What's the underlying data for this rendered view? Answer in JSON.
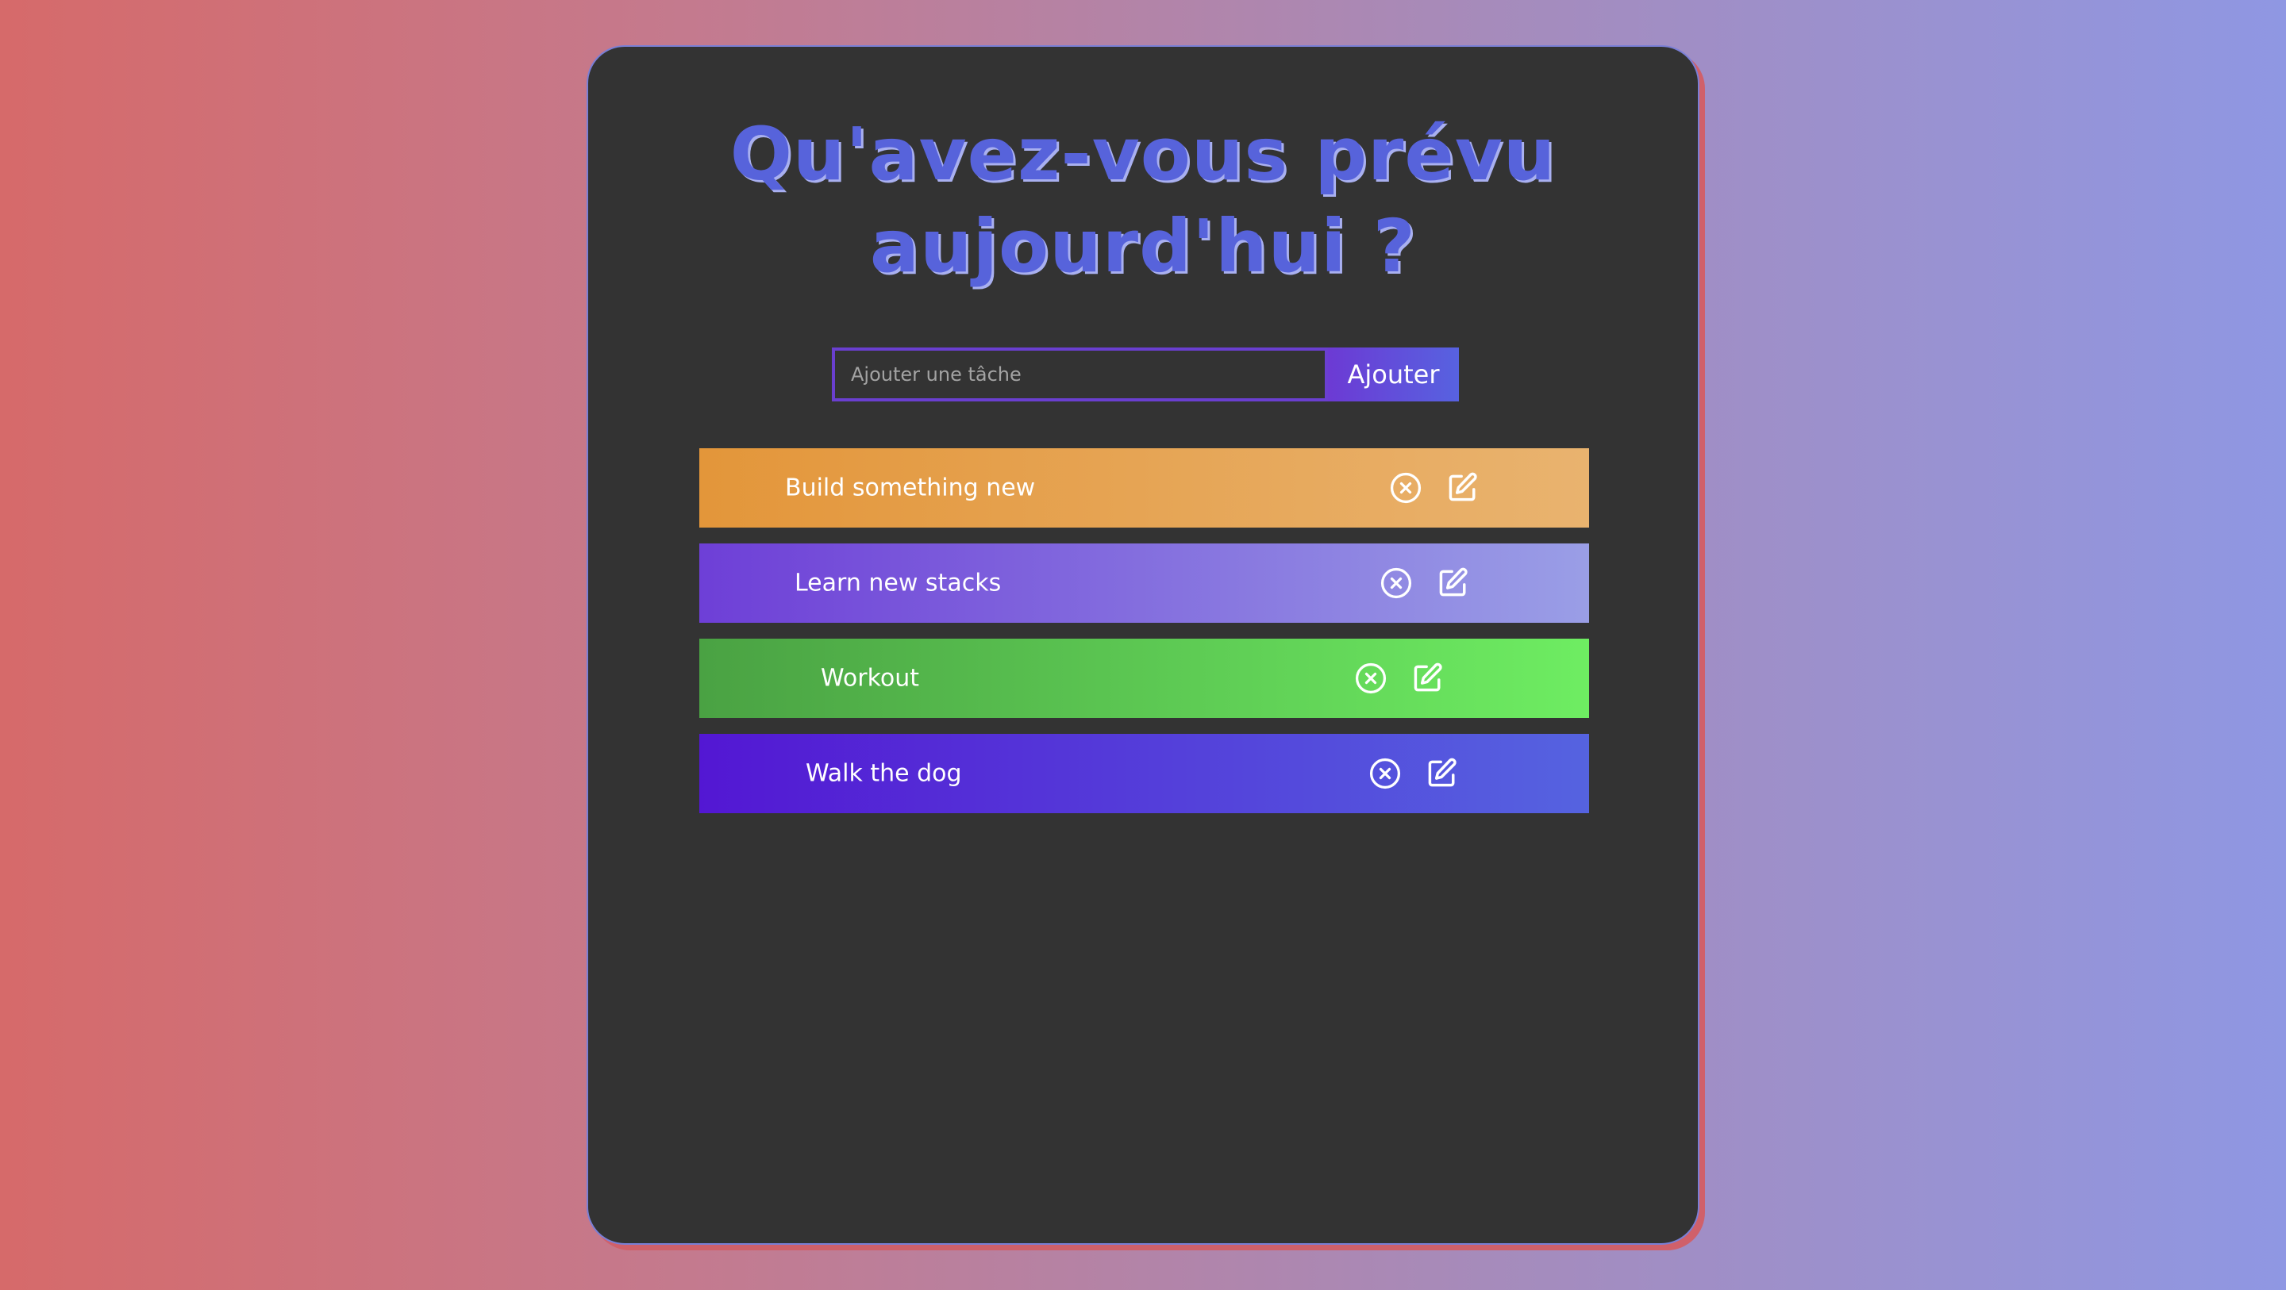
{
  "colors": {
    "background_gradient": [
      "#d66a6a",
      "#8f97e3"
    ],
    "card": "#333333",
    "title": "#5763db",
    "input_border": "#6a3fd0",
    "add_button": "#5f4fdb"
  },
  "header": {
    "title_line1": "Qu'avez-vous prévu",
    "title_line2": "aujourd'hui ?"
  },
  "form": {
    "input_placeholder": "Ajouter une tâche",
    "input_value": "",
    "add_label": "Ajouter"
  },
  "todos": [
    {
      "text": "Build something new",
      "color_start": "#e3963a",
      "color_end": "#e9b36f",
      "delete_icon": "x-circle-icon",
      "edit_icon": "edit-icon"
    },
    {
      "text": "Learn new stacks",
      "color_start": "#6e3fd7",
      "color_end": "#9a9ee6",
      "delete_icon": "x-circle-icon",
      "edit_icon": "edit-icon"
    },
    {
      "text": "Workout",
      "color_start": "#4aa243",
      "color_end": "#6eed62",
      "delete_icon": "x-circle-icon",
      "edit_icon": "edit-icon"
    },
    {
      "text": "Walk the dog",
      "color_start": "#5317d3",
      "color_end": "#5563e0",
      "delete_icon": "x-circle-icon",
      "edit_icon": "edit-icon"
    }
  ]
}
